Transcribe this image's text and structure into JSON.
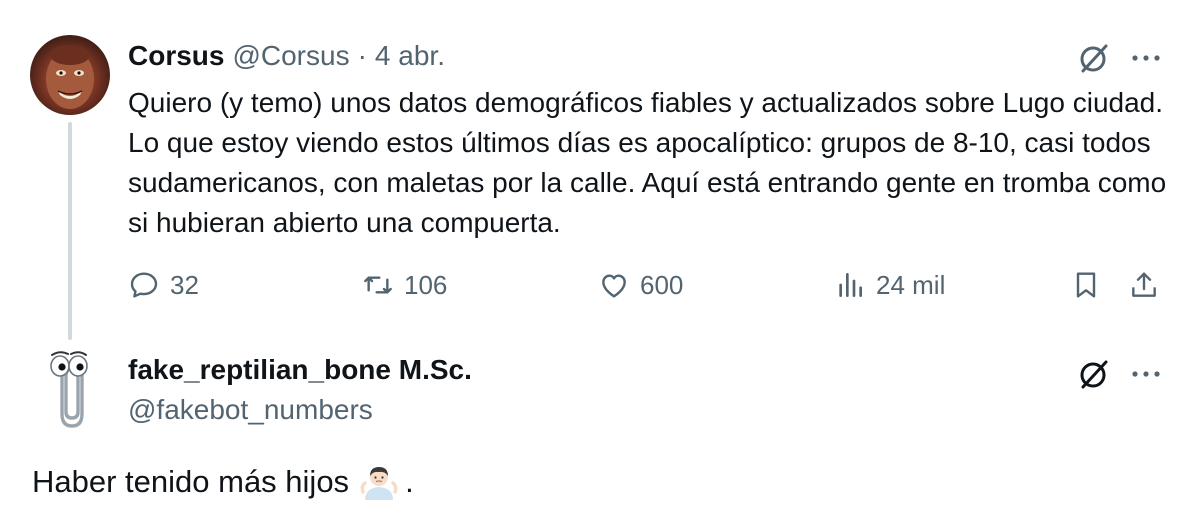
{
  "tweet": {
    "author_name": "Corsus",
    "author_handle": "@Corsus",
    "separator": "·",
    "date": "4 abr.",
    "text": "Quiero (y temo) unos datos demográficos fiables y actualizados sobre Lugo ciudad. Lo que estoy viendo estos últimos días es apocalíptico: grupos de 8-10, casi todos sudamericanos, con maletas por la calle. Aquí está entrando gente en tromba como si hubieran abierto una compuerta.",
    "stats": {
      "replies": "32",
      "retweets": "106",
      "likes": "600",
      "views": "24 mil"
    },
    "more_label": "···"
  },
  "reply": {
    "author_name": "fake_reptilian_bone M.Sc.",
    "author_handle": "@fakebot_numbers",
    "text_before_emoji": "Haber tenido más hijos",
    "text_after_emoji": ".",
    "more_label": "···"
  },
  "icons": {
    "grok": "grok-icon",
    "more": "more-icon",
    "reply": "reply-icon",
    "retweet": "retweet-icon",
    "like": "heart-icon",
    "views": "views-icon",
    "bookmark": "bookmark-icon",
    "share": "share-icon",
    "shrug": "person-shrugging-emoji"
  },
  "colors": {
    "text": "#0f1419",
    "secondary": "#536471",
    "thread_line": "#cfd9de"
  }
}
